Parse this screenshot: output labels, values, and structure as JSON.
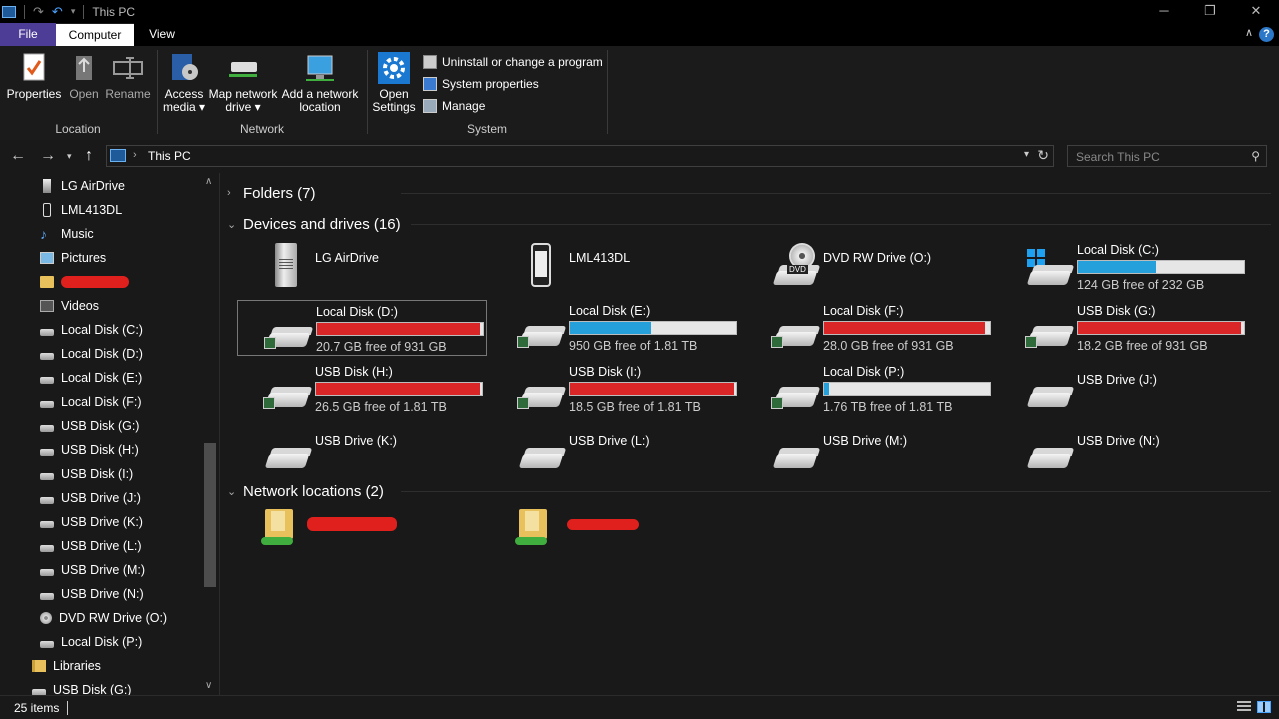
{
  "window": {
    "title": "This PC",
    "controls": {
      "minimize": "─",
      "restore": "❐",
      "close": "✕"
    }
  },
  "ribbon_tabs": [
    "File",
    "Computer",
    "View"
  ],
  "ribbon": {
    "location": {
      "label": "Location",
      "buttons": [
        "Properties",
        "Open",
        "Rename"
      ]
    },
    "network": {
      "label": "Network",
      "access_media": [
        "Access",
        "media ▾"
      ],
      "map_drive": [
        "Map network",
        "drive ▾"
      ],
      "add_location": [
        "Add a network",
        "location"
      ]
    },
    "system": {
      "label": "System",
      "open_settings": [
        "Open",
        "Settings"
      ],
      "uninstall": "Uninstall or change a program",
      "system_properties": "System properties",
      "manage": "Manage"
    }
  },
  "address": {
    "path": "This PC",
    "search_placeholder": "Search This PC"
  },
  "nav_pane": [
    {
      "label": "LG AirDrive",
      "icon": "server-icon"
    },
    {
      "label": "LML413DL",
      "icon": "phone-icon"
    },
    {
      "label": "Music",
      "icon": "music-icon"
    },
    {
      "label": "Pictures",
      "icon": "pictures-icon"
    },
    {
      "label": "",
      "icon": "folder-icon",
      "redacted": true
    },
    {
      "label": "Videos",
      "icon": "videos-icon"
    },
    {
      "label": "Local Disk (C:)",
      "icon": "drive-icon"
    },
    {
      "label": "Local Disk  (D:)",
      "icon": "drive-icon"
    },
    {
      "label": "Local Disk (E:)",
      "icon": "drive-icon"
    },
    {
      "label": "Local Disk  (F:)",
      "icon": "drive-icon"
    },
    {
      "label": "USB Disk (G:)",
      "icon": "drive-icon"
    },
    {
      "label": "USB Disk (H:)",
      "icon": "drive-icon"
    },
    {
      "label": "USB Disk (I:)",
      "icon": "drive-icon"
    },
    {
      "label": "USB Drive (J:)",
      "icon": "usb-drive-icon"
    },
    {
      "label": "USB Drive (K:)",
      "icon": "usb-drive-icon"
    },
    {
      "label": "USB Drive (L:)",
      "icon": "usb-drive-icon"
    },
    {
      "label": "USB Drive (M:)",
      "icon": "usb-drive-icon"
    },
    {
      "label": "USB Drive (N:)",
      "icon": "usb-drive-icon"
    },
    {
      "label": "DVD RW Drive (O:)",
      "icon": "dvd-icon"
    },
    {
      "label": "Local Disk (P:)",
      "icon": "drive-icon"
    },
    {
      "label": "Libraries",
      "icon": "libraries-icon"
    },
    {
      "label": "USB Disk (G:)",
      "icon": "drive-icon"
    }
  ],
  "sections": {
    "folders": "Folders (7)",
    "devices": "Devices and drives (16)",
    "network": "Network locations (2)"
  },
  "devices": [
    {
      "name": "LG AirDrive",
      "icon": "server-icon",
      "fill": null,
      "free": null,
      "bar_color": null
    },
    {
      "name": "LML413DL",
      "icon": "phone-icon",
      "fill": null,
      "free": null,
      "bar_color": null
    },
    {
      "name": "DVD RW Drive (O:)",
      "icon": "dvd-icon",
      "fill": null,
      "free": null,
      "bar_color": null
    },
    {
      "name": "Local Disk (C:)",
      "icon": "windows-drive-icon",
      "fill": 0.47,
      "free": "124 GB free of 232 GB",
      "bar_color": "#26a0da"
    },
    {
      "name": "Local Disk  (D:)",
      "icon": "drive-icon",
      "fill": 0.98,
      "free": "20.7 GB free of 931 GB",
      "bar_color": "#da2626",
      "selected": true
    },
    {
      "name": "Local Disk (E:)",
      "icon": "drive-icon",
      "fill": 0.49,
      "free": "950 GB free of 1.81 TB",
      "bar_color": "#26a0da"
    },
    {
      "name": "Local Disk  (F:)",
      "icon": "drive-icon",
      "fill": 0.97,
      "free": "28.0 GB free of 931 GB",
      "bar_color": "#da2626"
    },
    {
      "name": "USB Disk (G:)",
      "icon": "drive-icon",
      "fill": 0.98,
      "free": "18.2 GB free of 931 GB",
      "bar_color": "#da2626"
    },
    {
      "name": "USB Disk (H:)",
      "icon": "drive-icon",
      "fill": 0.99,
      "free": "26.5 GB free of 1.81 TB",
      "bar_color": "#da2626"
    },
    {
      "name": "USB Disk (I:)",
      "icon": "drive-icon",
      "fill": 0.99,
      "free": "18.5 GB free of 1.81 TB",
      "bar_color": "#da2626"
    },
    {
      "name": "Local Disk (P:)",
      "icon": "drive-icon",
      "fill": 0.03,
      "free": "1.76 TB free of 1.81 TB",
      "bar_color": "#26a0da"
    },
    {
      "name": "USB Drive (J:)",
      "icon": "usb-drive-icon",
      "fill": null,
      "free": null,
      "bar_color": null
    },
    {
      "name": "USB Drive (K:)",
      "icon": "usb-drive-icon",
      "fill": null,
      "free": null,
      "bar_color": null
    },
    {
      "name": "USB Drive (L:)",
      "icon": "usb-drive-icon",
      "fill": null,
      "free": null,
      "bar_color": null
    },
    {
      "name": "USB Drive (M:)",
      "icon": "usb-drive-icon",
      "fill": null,
      "free": null,
      "bar_color": null
    },
    {
      "name": "USB Drive (N:)",
      "icon": "usb-drive-icon",
      "fill": null,
      "free": null,
      "bar_color": null
    }
  ],
  "network_locations": [
    {
      "name": "",
      "icon": "network-folder-icon",
      "redacted": true
    },
    {
      "name": "",
      "icon": "network-folder-icon",
      "redacted": true
    }
  ],
  "status": {
    "items": "25 items"
  }
}
